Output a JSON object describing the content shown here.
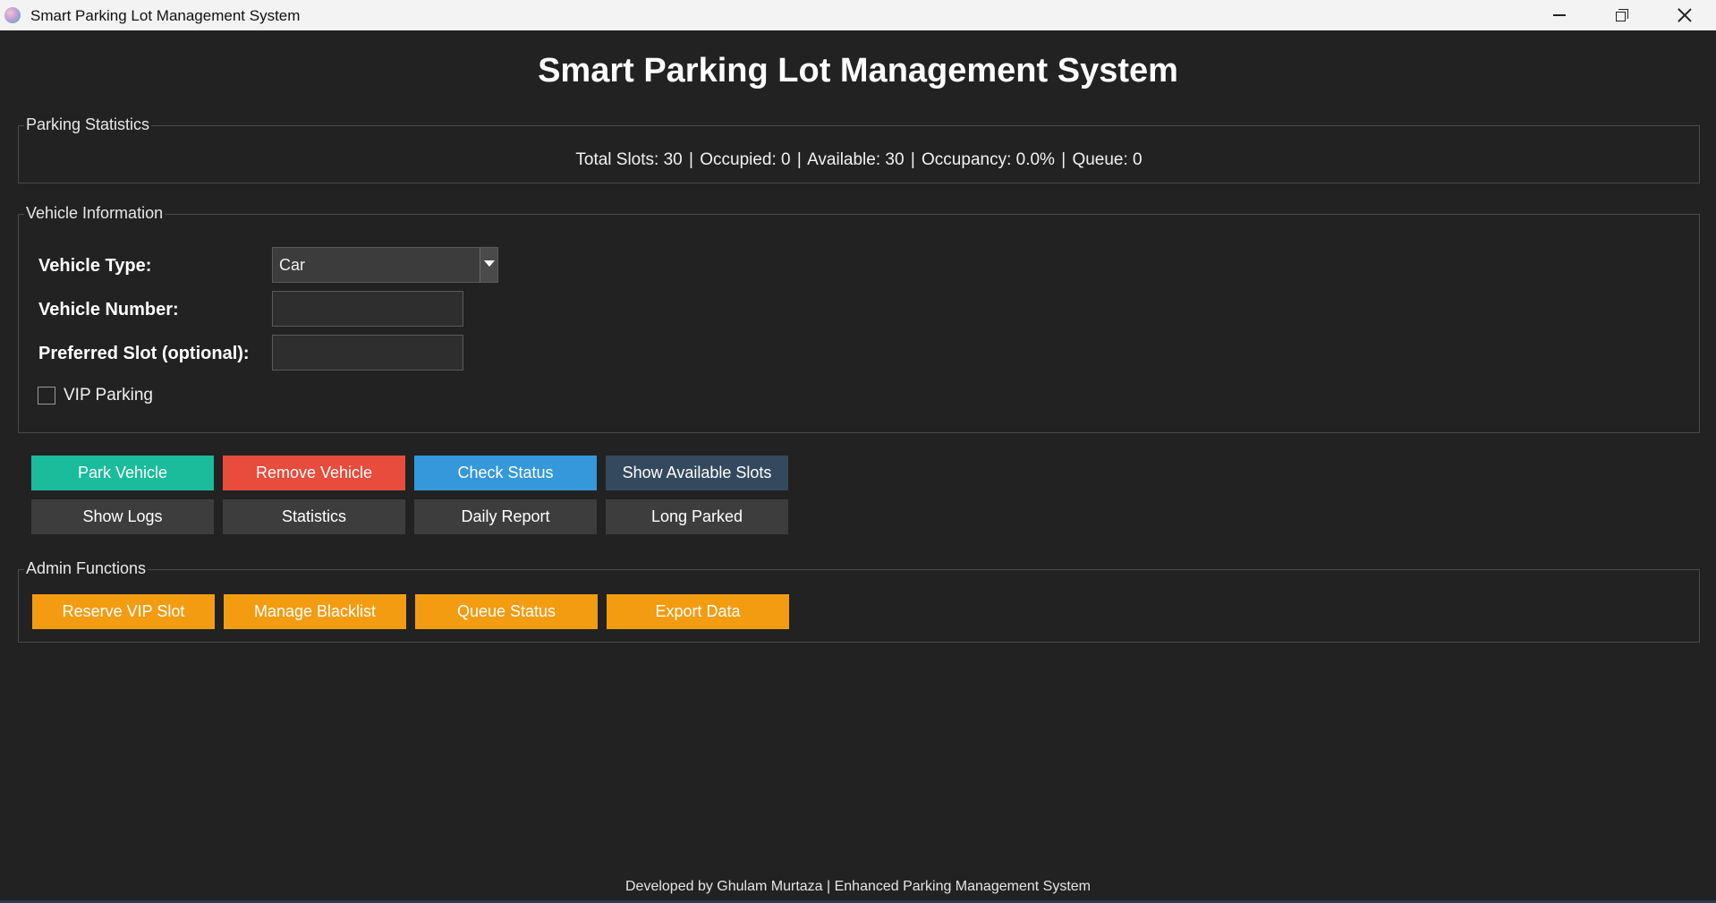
{
  "window": {
    "title": "Smart Parking Lot Management System",
    "icon": "app-globe-icon"
  },
  "header": {
    "title": "Smart Parking Lot Management System"
  },
  "stats": {
    "legend": "Parking Statistics",
    "total": "Total Slots: 30",
    "occupied": "Occupied: 0",
    "available": "Available: 30",
    "occupancy": "Occupancy: 0.0%",
    "queue": "Queue: 0",
    "separator": "|"
  },
  "vehicle": {
    "legend": "Vehicle Information",
    "type_label": "Vehicle Type:",
    "type_value": "Car",
    "number_label": "Vehicle Number:",
    "number_value": "",
    "slot_label": "Preferred Slot (optional):",
    "slot_value": "",
    "vip_label": "VIP Parking",
    "vip_checked": false
  },
  "actions": {
    "park": "Park Vehicle",
    "remove": "Remove Vehicle",
    "check": "Check Status",
    "available": "Show Available Slots",
    "logs": "Show Logs",
    "statistics": "Statistics",
    "daily": "Daily Report",
    "long_parked": "Long Parked"
  },
  "admin": {
    "legend": "Admin Functions",
    "reserve": "Reserve VIP Slot",
    "blacklist": "Manage Blacklist",
    "queue": "Queue Status",
    "export": "Export Data"
  },
  "footer": {
    "text": "Developed by Ghulam Murtaza | Enhanced Parking Management System"
  },
  "colors": {
    "background": "#222222",
    "park": "#1abc9c",
    "remove": "#e74c3c",
    "check": "#3498db",
    "available": "#34495e",
    "secondary": "#3d3d3d",
    "admin": "#f39c12"
  }
}
